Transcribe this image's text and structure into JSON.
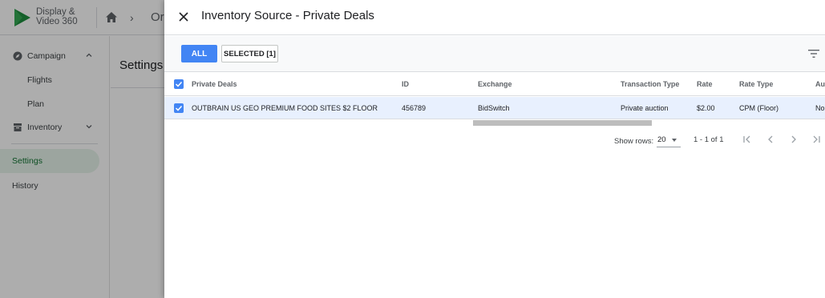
{
  "app": {
    "brand_line1": "Display &",
    "brand_line2": "Video 360",
    "breadcrumb_partial": "Or",
    "sidebar": {
      "items": [
        {
          "label": "Campaign"
        },
        {
          "label": "Flights"
        },
        {
          "label": "Plan"
        },
        {
          "label": "Inventory"
        },
        {
          "label": "Settings"
        },
        {
          "label": "History"
        }
      ]
    },
    "main_title": "Settings"
  },
  "dialog": {
    "title": "Inventory Source - Private Deals",
    "filters": {
      "all_label": "ALL",
      "selected_label": "SELECTED [1]"
    },
    "table": {
      "columns": [
        "Private Deals",
        "ID",
        "Exchange",
        "Transaction Type",
        "Rate",
        "Rate Type",
        "Au"
      ],
      "rows": [
        {
          "checked": true,
          "deal": "OUTBRAIN US GEO PREMIUM FOOD SITES $2 FLOOR",
          "id": "456789",
          "exchange": "BidSwitch",
          "transaction_type": "Private auction",
          "rate": "$2.00",
          "rate_type": "CPM (Floor)",
          "extra": "No"
        }
      ]
    },
    "pagination": {
      "show_rows_label": "Show rows:",
      "rows_value": "20",
      "range_text": "1 - 1 of 1"
    }
  },
  "colors": {
    "accent_blue": "#4285f4",
    "selected_row_bg": "#e8f0fe",
    "active_nav_bg": "#e6f4ea",
    "active_nav_text": "#137333"
  },
  "icons": [
    "logo-play-icon",
    "home-icon",
    "close-icon",
    "filter-icon",
    "first-page-icon",
    "prev-page-icon",
    "next-page-icon",
    "last-page-icon"
  ]
}
